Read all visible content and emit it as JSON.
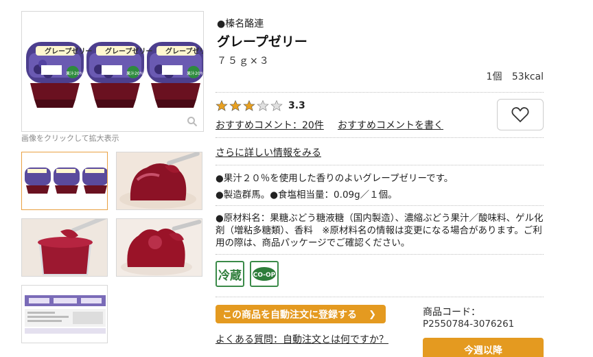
{
  "gallery": {
    "caption": "画像をクリックして拡大表示",
    "package_label": "グレープゼリー",
    "juice_label": "果汁20%"
  },
  "product": {
    "brand": "●榛名酪連",
    "title": "グレープゼリー",
    "volume": "７５ｇ×３",
    "kcal": "1個 53kcal"
  },
  "rating": {
    "value": "3.3",
    "stars_filled": 3,
    "stars_total": 5,
    "comments_link": "おすすめコメント：20件",
    "write_link": "おすすめコメントを書く"
  },
  "more_info_link": "さらに詳しい情報をみる",
  "description": {
    "line1": "●果汁２０％を使用した香りのよいグレープゼリーです。",
    "line2": "●製造群馬。●食塩相当量：0.09g／１個。",
    "ingredients": "●原材料名：果糖ぶどう糖液糖（国内製造）、濃縮ぶどう果汁／酸味料、ゲル化剤（増粘多糖類）、香料　※原材料名の情報は変更になる場合があります。ご利用の際は、商品パッケージでご確認ください。"
  },
  "badges": {
    "cold": "冷蔵",
    "coop": "CO-OP"
  },
  "auto_order_button": "この商品を自動注文に登録する",
  "faq_link": "よくある質問：自動注文とは何ですか？",
  "product_code": {
    "label": "商品コード：",
    "value": "P2550784-3076261"
  },
  "week_button": "今週以降",
  "colors": {
    "accent": "#e49a20",
    "star": "#e8a020",
    "green": "#3a8a48"
  }
}
